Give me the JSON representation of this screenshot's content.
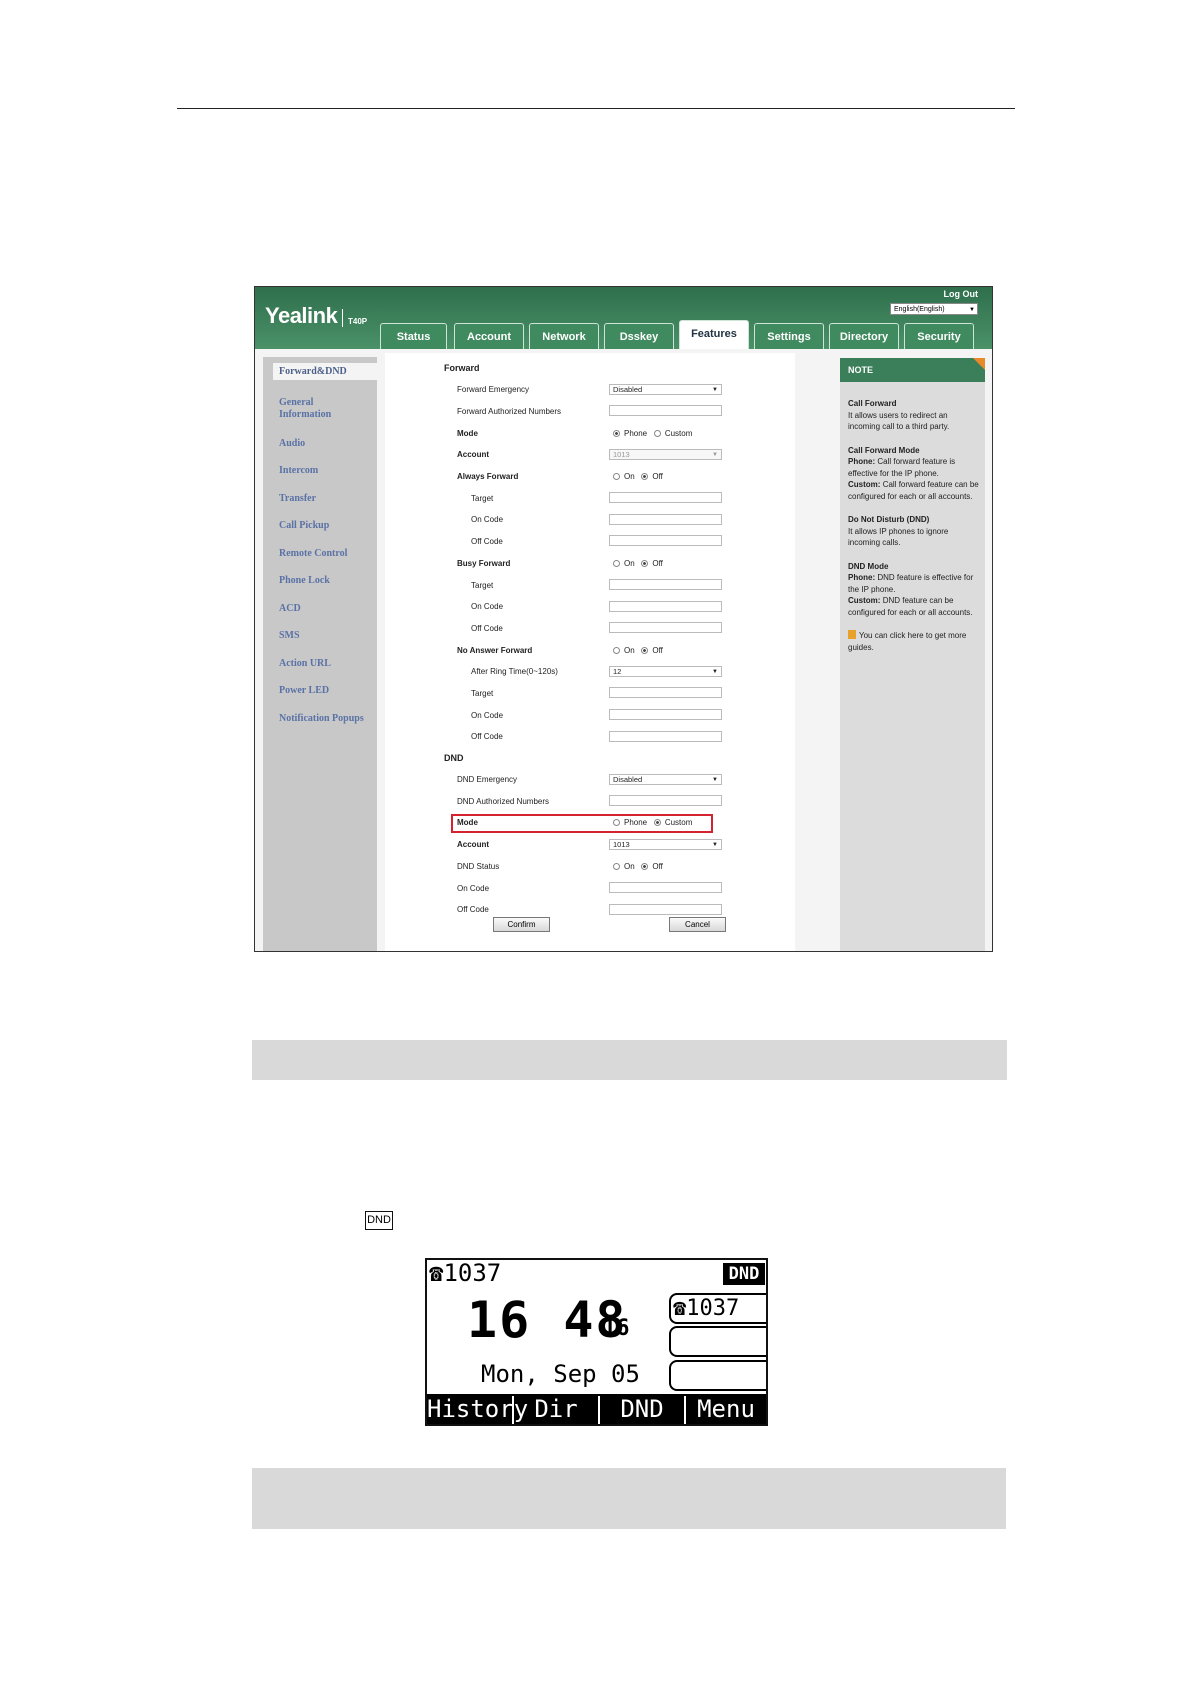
{
  "webui": {
    "logo": "Yealink",
    "model": "T40P",
    "logout": "Log Out",
    "language": "English(English)",
    "tabs": [
      "Status",
      "Account",
      "Network",
      "Dsskey",
      "Features",
      "Settings",
      "Directory",
      "Security"
    ],
    "active_tab": "Features",
    "sidebar": [
      "Forward&DND",
      "General Information",
      "Audio",
      "Intercom",
      "Transfer",
      "Call Pickup",
      "Remote Control",
      "Phone Lock",
      "ACD",
      "SMS",
      "Action URL",
      "Power LED",
      "Notification Popups"
    ],
    "forward": {
      "section": "Forward",
      "emergency_label": "Forward Emergency",
      "emergency_value": "Disabled",
      "authorized_label": "Forward Authorized Numbers",
      "mode_label": "Mode",
      "mode_phone": "Phone",
      "mode_custom": "Custom",
      "account_label": "Account",
      "account_value": "1013",
      "always_label": "Always Forward",
      "busy_label": "Busy Forward",
      "noanswer_label": "No Answer Forward",
      "on": "On",
      "off": "Off",
      "target": "Target",
      "on_code": "On Code",
      "off_code": "Off Code",
      "ring_time_label": "After Ring Time(0~120s)",
      "ring_time_value": "12"
    },
    "dnd": {
      "section": "DND",
      "emergency_label": "DND Emergency",
      "emergency_value": "Disabled",
      "authorized_label": "DND Authorized Numbers",
      "mode_label": "Mode",
      "mode_phone": "Phone",
      "mode_custom": "Custom",
      "account_label": "Account",
      "account_value": "1013",
      "status_label": "DND Status",
      "on": "On",
      "off": "Off",
      "on_code": "On Code",
      "off_code": "Off Code"
    },
    "buttons": {
      "confirm": "Confirm",
      "cancel": "Cancel"
    },
    "note": {
      "header": "NOTE",
      "call_forward_title": "Call Forward",
      "call_forward_text": "It allows users to redirect an incoming call to a third party.",
      "cf_mode_title": "Call Forward Mode",
      "cf_mode_phone_bold": "Phone:",
      "cf_mode_phone_text": "Call forward feature is effective for the IP phone.",
      "cf_mode_custom_bold": "Custom:",
      "cf_mode_custom_text": "Call forward feature can be configured for each or all accounts.",
      "dnd_title": "Do Not Disturb (DND)",
      "dnd_text": "It allows IP phones to ignore incoming calls.",
      "dnd_mode_title": "DND Mode",
      "dnd_mode_phone_bold": "Phone:",
      "dnd_mode_phone_text": "DND feature is effective for the IP phone.",
      "dnd_mode_custom_bold": "Custom:",
      "dnd_mode_custom_text": "DND feature can be configured for each or all accounts.",
      "guide_text": "You can click here to get more guides."
    },
    "colors": {
      "header_green": "#3a7f5a",
      "highlight_red": "#d4232e",
      "note_orange": "#e88a2a"
    }
  },
  "dnd_key_label": "DND",
  "phone_lcd": {
    "account": "1037",
    "dnd_badge": "DND",
    "time_hours": "16",
    "time_minutes": "48",
    "time_seconds": "16",
    "date": "Mon, Sep 05",
    "line_key_1": "1037",
    "softkeys": [
      "History",
      "Dir",
      "DND",
      "Menu"
    ]
  }
}
